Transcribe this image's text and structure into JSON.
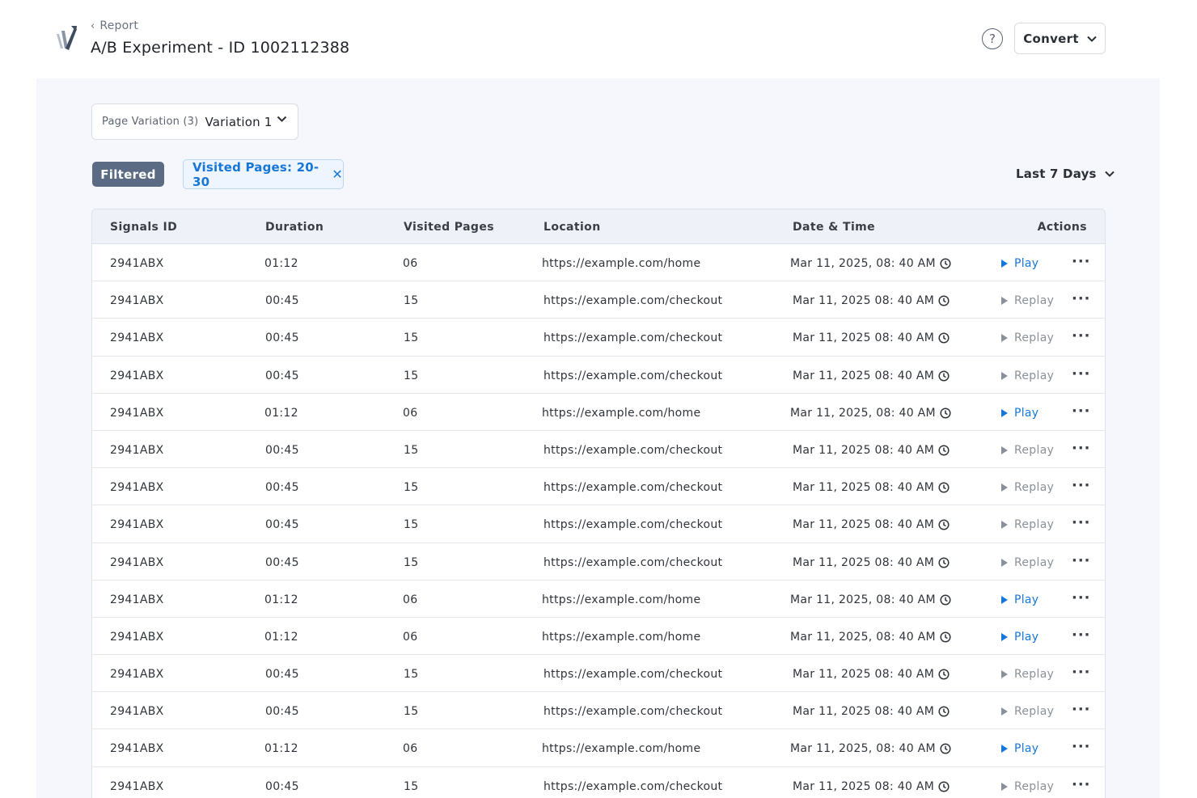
{
  "header": {
    "breadcrumb": "Report",
    "title": "A/B Experiment - ID 1002112388",
    "help_label": "?",
    "convert_label": "Convert"
  },
  "toolbar": {
    "variation_label": "Page Variation (3)",
    "variation_value": "Variation 1",
    "filtered_label": "Filtered",
    "filter_chip": "Visited Pages: 20-30",
    "range_label": "Last 7 Days"
  },
  "table": {
    "columns": [
      "Signals ID",
      "Duration",
      "Visited Pages",
      "Location",
      "Date & Time",
      "Actions"
    ],
    "rows": [
      {
        "id": "2941ABX",
        "duration": "01:12",
        "pages": "06",
        "location": "https://example.com/home",
        "datetime": "Mar 11, 2025,  08: 40 AM",
        "action": "Play"
      },
      {
        "id": "2941ABX",
        "duration": "00:45",
        "pages": "15",
        "location": "https://example.com/checkout",
        "datetime": "Mar 11, 2025  08: 40 AM",
        "action": "Replay"
      },
      {
        "id": "2941ABX",
        "duration": "00:45",
        "pages": "15",
        "location": "https://example.com/checkout",
        "datetime": "Mar 11, 2025  08: 40 AM",
        "action": "Replay"
      },
      {
        "id": "2941ABX",
        "duration": "00:45",
        "pages": "15",
        "location": "https://example.com/checkout",
        "datetime": "Mar 11, 2025  08: 40 AM",
        "action": "Replay"
      },
      {
        "id": "2941ABX",
        "duration": "01:12",
        "pages": "06",
        "location": "https://example.com/home",
        "datetime": "Mar 11, 2025,  08: 40 AM",
        "action": "Play"
      },
      {
        "id": "2941ABX",
        "duration": "00:45",
        "pages": "15",
        "location": "https://example.com/checkout",
        "datetime": "Mar 11, 2025  08: 40 AM",
        "action": "Replay"
      },
      {
        "id": "2941ABX",
        "duration": "00:45",
        "pages": "15",
        "location": "https://example.com/checkout",
        "datetime": "Mar 11, 2025  08: 40 AM",
        "action": "Replay"
      },
      {
        "id": "2941ABX",
        "duration": "00:45",
        "pages": "15",
        "location": "https://example.com/checkout",
        "datetime": "Mar 11, 2025  08: 40 AM",
        "action": "Replay"
      },
      {
        "id": "2941ABX",
        "duration": "00:45",
        "pages": "15",
        "location": "https://example.com/checkout",
        "datetime": "Mar 11, 2025  08: 40 AM",
        "action": "Replay"
      },
      {
        "id": "2941ABX",
        "duration": "01:12",
        "pages": "06",
        "location": "https://example.com/home",
        "datetime": "Mar 11, 2025,  08: 40 AM",
        "action": "Play"
      },
      {
        "id": "2941ABX",
        "duration": "01:12",
        "pages": "06",
        "location": "https://example.com/home",
        "datetime": "Mar 11, 2025,  08: 40 AM",
        "action": "Play"
      },
      {
        "id": "2941ABX",
        "duration": "00:45",
        "pages": "15",
        "location": "https://example.com/checkout",
        "datetime": "Mar 11, 2025  08: 40 AM",
        "action": "Replay"
      },
      {
        "id": "2941ABX",
        "duration": "00:45",
        "pages": "15",
        "location": "https://example.com/checkout",
        "datetime": "Mar 11, 2025  08: 40 AM",
        "action": "Replay"
      },
      {
        "id": "2941ABX",
        "duration": "01:12",
        "pages": "06",
        "location": "https://example.com/home",
        "datetime": "Mar 11, 2025,  08: 40 AM",
        "action": "Play"
      },
      {
        "id": "2941ABX",
        "duration": "00:45",
        "pages": "15",
        "location": "https://example.com/checkout",
        "datetime": "Mar 11, 2025  08: 40 AM",
        "action": "Replay"
      }
    ]
  },
  "colors": {
    "accent": "#1677d8",
    "badge": "#5b6b84",
    "background": "#f5f7fd"
  }
}
